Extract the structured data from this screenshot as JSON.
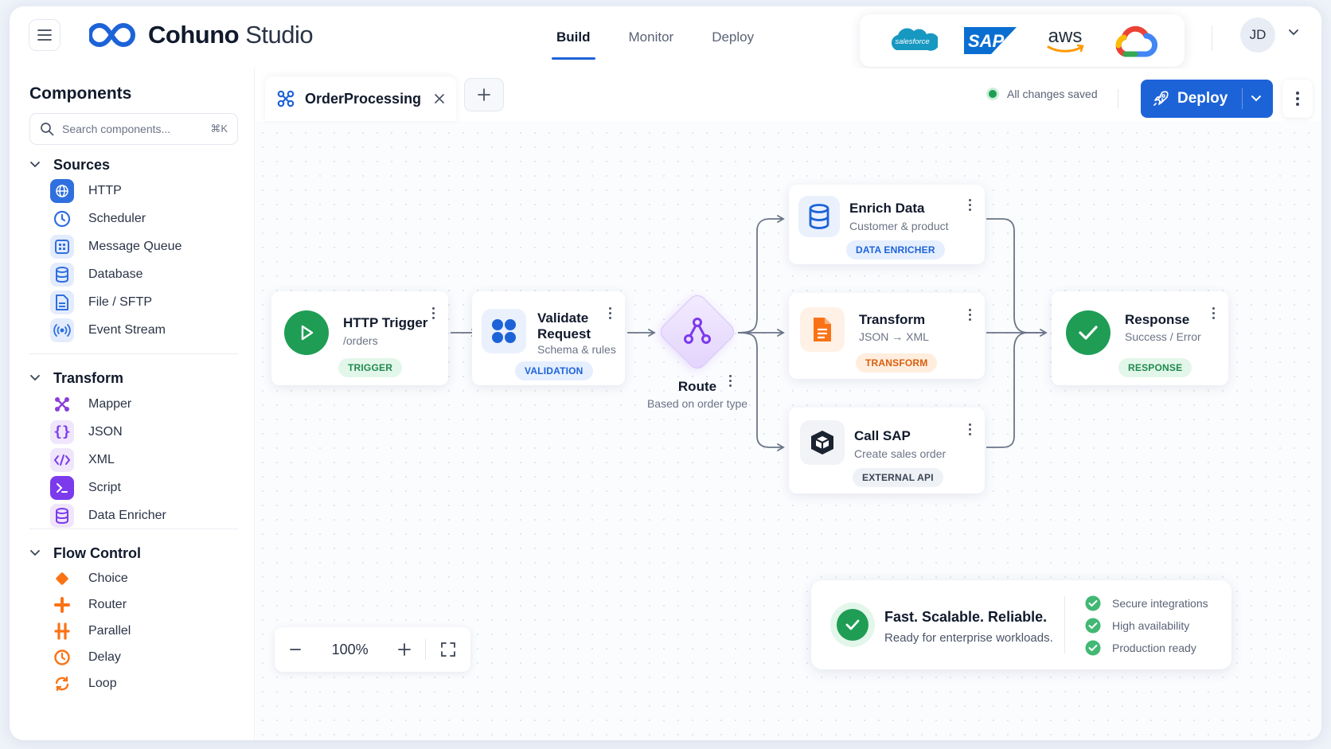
{
  "app": {
    "name": "Cohuno",
    "name_suffix": "Studio",
    "nav_tabs": [
      "Build",
      "Monitor",
      "Deploy"
    ],
    "active_nav": "Build",
    "partners": [
      "salesforce-logo",
      "SAP",
      "aws",
      "google-cloud-logo"
    ],
    "partner_text": {
      "salesforce": "salesforce",
      "sap": "SAP",
      "aws": "aws"
    },
    "user_initials": "JD"
  },
  "sidebar": {
    "title": "Components",
    "search_placeholder": "Search components...",
    "search_shortcut": "⌘K",
    "sections": [
      {
        "label": "Sources",
        "items": [
          "HTTP",
          "Scheduler",
          "Message Queue",
          "Database",
          "File / SFTP",
          "Event Stream"
        ]
      },
      {
        "label": "Transform",
        "items": [
          "Mapper",
          "JSON",
          "XML",
          "Script",
          "Data Enricher"
        ]
      },
      {
        "label": "Flow Control",
        "items": [
          "Choice",
          "Router",
          "Parallel",
          "Delay",
          "Loop"
        ]
      }
    ]
  },
  "editor": {
    "tab_name": "OrderProcessing",
    "status": "All changes saved",
    "deploy_label": "Deploy",
    "zoom": "100%"
  },
  "flow": {
    "nodes": [
      {
        "title": "HTTP Trigger",
        "subtitle": "/orders",
        "badge": "TRIGGER"
      },
      {
        "title": "Validate Request",
        "title_line1": "Validate",
        "title_line2": "Request",
        "subtitle": "Schema & rules",
        "badge": "VALIDATION"
      },
      {
        "title": "Route",
        "subtitle": "Based on order type"
      },
      {
        "title": "Enrich Data",
        "subtitle": "Customer & product",
        "badge": "DATA ENRICHER"
      },
      {
        "title": "Transform",
        "subtitle": "JSON → XML",
        "badge": "TRANSFORM"
      },
      {
        "title": "Call SAP",
        "subtitle": "Create sales order",
        "badge": "EXTERNAL API"
      },
      {
        "title": "Response",
        "subtitle": "Success / Error",
        "badge": "RESPONSE"
      }
    ]
  },
  "promo": {
    "headline": "Fast. Scalable. Reliable.",
    "subline": "Ready for enterprise workloads.",
    "features": [
      "Secure integrations",
      "High availability",
      "Production ready"
    ]
  },
  "colors": {
    "brand_blue": "#1d63d8",
    "success_green": "#1f9d55",
    "route_purple": "#7c3aed",
    "transform_orange": "#f97316"
  }
}
